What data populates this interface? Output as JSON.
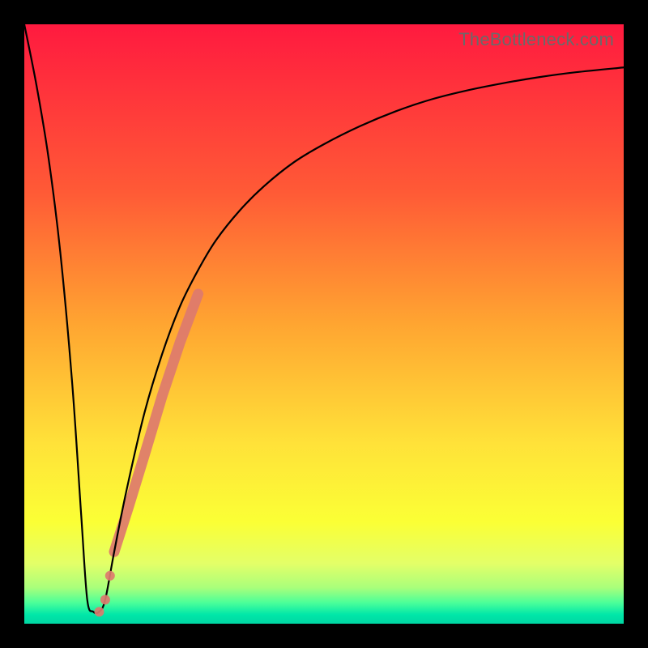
{
  "watermark": "TheBottleneck.com",
  "chart_data": {
    "type": "line",
    "title": "",
    "xlabel": "",
    "ylabel": "",
    "xlim": [
      0,
      100
    ],
    "ylim": [
      0,
      100
    ],
    "gradient_stops": [
      {
        "offset": 0,
        "color": "#ff1a3f"
      },
      {
        "offset": 0.28,
        "color": "#ff5a36"
      },
      {
        "offset": 0.5,
        "color": "#ffa531"
      },
      {
        "offset": 0.7,
        "color": "#ffe239"
      },
      {
        "offset": 0.83,
        "color": "#fbff35"
      },
      {
        "offset": 0.9,
        "color": "#e3ff68"
      },
      {
        "offset": 0.94,
        "color": "#a9ff7b"
      },
      {
        "offset": 0.965,
        "color": "#4bff99"
      },
      {
        "offset": 0.985,
        "color": "#00e7a8"
      },
      {
        "offset": 1.0,
        "color": "#00d7a3"
      }
    ],
    "series": [
      {
        "name": "bottleneck-curve",
        "color": "#000000",
        "stroke_width": 2.2,
        "x": [
          0,
          2,
          4,
          6,
          8,
          9.5,
          10.5,
          11.5,
          12.5,
          13.5,
          15,
          17,
          20,
          23,
          26,
          29,
          32,
          36,
          40,
          45,
          50,
          56,
          62,
          68,
          74,
          80,
          86,
          92,
          100
        ],
        "y": [
          100,
          90,
          78,
          62,
          40,
          18,
          4,
          2,
          2,
          4,
          12,
          22,
          35,
          45,
          53,
          59,
          64,
          69,
          73,
          77,
          80,
          83,
          85.5,
          87.5,
          89,
          90.2,
          91.2,
          92,
          92.8
        ]
      }
    ],
    "markers": {
      "name": "highlight-segment",
      "color": "#dd7a6e",
      "radius": 6,
      "segment_stroke_width": 13,
      "points": [
        {
          "x": 15.0,
          "y": 12.0
        },
        {
          "x": 15.8,
          "y": 14.5
        },
        {
          "x": 16.6,
          "y": 17.0
        },
        {
          "x": 17.4,
          "y": 19.5
        },
        {
          "x": 20.0,
          "y": 28.0
        },
        {
          "x": 23.0,
          "y": 38.0
        },
        {
          "x": 26.0,
          "y": 47.0
        },
        {
          "x": 29.0,
          "y": 55.0
        }
      ],
      "isolated_points": [
        {
          "x": 13.5,
          "y": 4.0
        },
        {
          "x": 14.3,
          "y": 8.0
        },
        {
          "x": 12.5,
          "y": 2.0
        }
      ]
    }
  }
}
